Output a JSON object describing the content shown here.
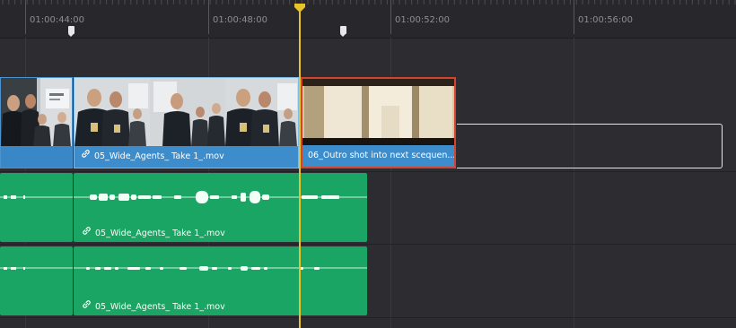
{
  "ruler": {
    "timecodes": [
      "01:00:44:00",
      "01:00:48:00",
      "01:00:52:00",
      "01:00:56:00"
    ]
  },
  "video_track": {
    "clips": [
      {
        "name": ""
      },
      {
        "name": "05_Wide_Agents_ Take 1_.mov"
      },
      {
        "name": "06_Outro shot into next scequen..."
      }
    ]
  },
  "audio_track_1": {
    "clips": [
      {
        "name": ""
      },
      {
        "name": "05_Wide_Agents_ Take 1_.mov"
      }
    ]
  },
  "audio_track_2": {
    "clips": [
      {
        "name": ""
      },
      {
        "name": "05_Wide_Agents_ Take 1_.mov"
      }
    ]
  },
  "colors": {
    "video_clip": "#3a87c7",
    "audio_clip": "#1aa564",
    "playhead": "#e7c22a",
    "selected_clip_border": "#d5432e"
  },
  "icons": [
    "link-icon",
    "playhead-icon",
    "marker-icon"
  ]
}
